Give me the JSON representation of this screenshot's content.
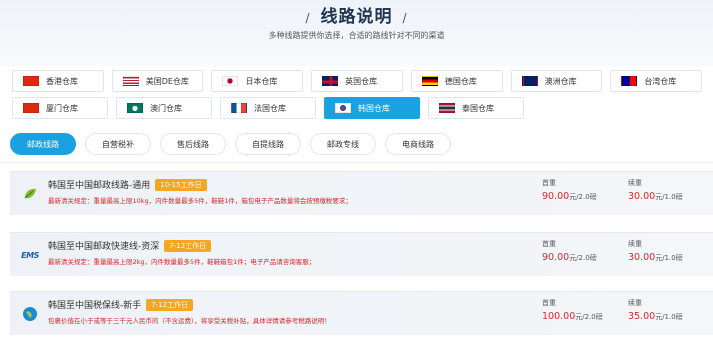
{
  "header": {
    "title": "线路说明",
    "slash_left": "/",
    "slash_right": "/",
    "subtitle": "多种线路提供你选择，合适的路线针对不同的渠道"
  },
  "warehouses_row1": [
    {
      "label": "香港仓库",
      "flag": "hk-flag"
    },
    {
      "label": "美国DE仓库",
      "flag": "us-flag"
    },
    {
      "label": "日本仓库",
      "flag": "jp-flag"
    },
    {
      "label": "英国仓库",
      "flag": "uk-flag"
    },
    {
      "label": "德国仓库",
      "flag": "de-flag"
    },
    {
      "label": "澳洲仓库",
      "flag": "au-flag"
    },
    {
      "label": "台湾仓库",
      "flag": "tw-flag"
    }
  ],
  "warehouses_row2": [
    {
      "label": "厦门仓库",
      "flag": "cn-flag"
    },
    {
      "label": "澳门仓库",
      "flag": "mo-flag"
    },
    {
      "label": "法国仓库",
      "flag": "fr-flag"
    },
    {
      "label": "韩国仓库",
      "flag": "kr-flag",
      "active": true
    },
    {
      "label": "泰国仓库",
      "flag": "th-flag"
    }
  ],
  "tabs": [
    {
      "label": "邮政线路",
      "active": true
    },
    {
      "label": "自营税补"
    },
    {
      "label": "售后线路"
    },
    {
      "label": "自提线路"
    },
    {
      "label": "邮政专线"
    },
    {
      "label": "电商线路"
    }
  ],
  "routes": [
    {
      "name": "韩国至中国邮政线路-通用",
      "badge": "10-15工作日",
      "note": "最新清关规定：重量最高上限10kg，内件数量最多5件，鞋鞋1件，箱包电子产品数量将会按预缴税要求；",
      "icon": "leaf-logo-icon",
      "first_label": "首重",
      "first_price": "90.00",
      "first_unit": "元/2.0磅",
      "cont_label": "续重",
      "cont_price": "30.00",
      "cont_unit": "元/1.0磅"
    },
    {
      "name": "韩国至中国邮政快速线-资深",
      "badge": "7-12工作日",
      "note": "最新清关规定：重量最高上限2kg，内件数量最多5件，鞋鞋箱包1件；电子产品请咨询客服；",
      "icon": "ems-logo-icon",
      "first_label": "首重",
      "first_price": "90.00",
      "first_unit": "元/2.0磅",
      "cont_label": "续重",
      "cont_price": "30.00",
      "cont_unit": "元/1.0磅"
    },
    {
      "name": "韩国至中国税保线-新手",
      "badge": "7-12工作日",
      "note": "包裹价值在小于或等于三千元人民币的（不含运费），将享受关税补贴，具体详情请参考税路说明！",
      "icon": "globe-icon",
      "first_label": "首重",
      "first_price": "100.00",
      "first_unit": "元/2.0磅",
      "cont_label": "续重",
      "cont_price": "35.00",
      "cont_unit": "元/1.0磅"
    }
  ],
  "colors": {
    "accent": "#1aa1e0",
    "price": "#d9282d",
    "badge": "#f5a623"
  }
}
